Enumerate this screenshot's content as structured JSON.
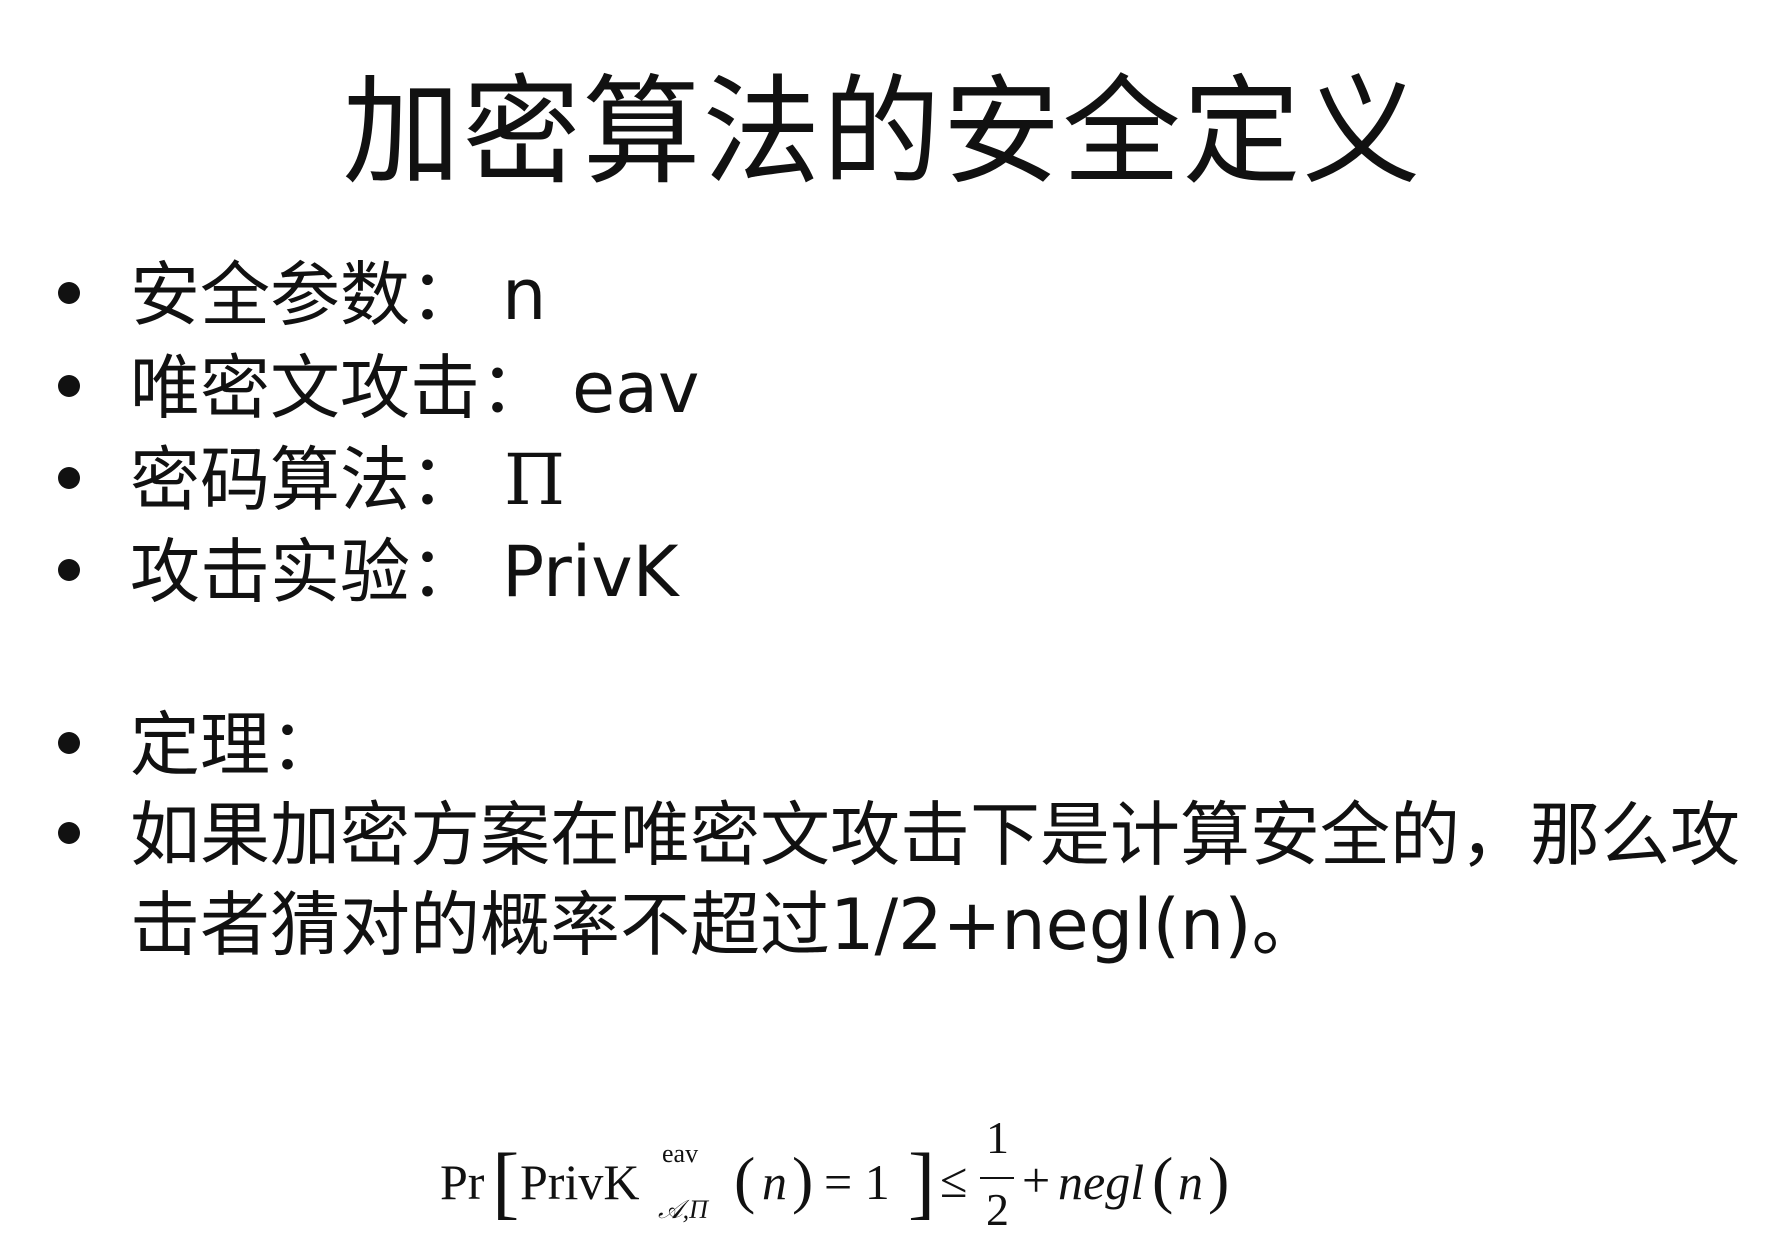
{
  "slide": {
    "title": "加密算法的安全定义"
  },
  "bullets": [
    {
      "label": "安全参数：",
      "value": "n"
    },
    {
      "label": "唯密文攻击：",
      "value": "eav"
    },
    {
      "label": "密码算法：",
      "value": "Π"
    },
    {
      "label": "攻击实验：",
      "value": "PrivK"
    }
  ],
  "theorem": {
    "label": "定理：",
    "statement": "如果加密方案在唯密文攻击下是计算安全的，那么攻击者猜对的概率不超过1/2+negl(n)。"
  },
  "formula": {
    "pr": "Pr",
    "privk": "PrivK",
    "superscript": "eav",
    "subscript": "𝒜,Π",
    "arg": "n",
    "equals": "= 1",
    "leq": "≤",
    "numerator": "1",
    "denominator": "2",
    "plus": "+",
    "negl": "negl",
    "negl_arg": "n"
  }
}
